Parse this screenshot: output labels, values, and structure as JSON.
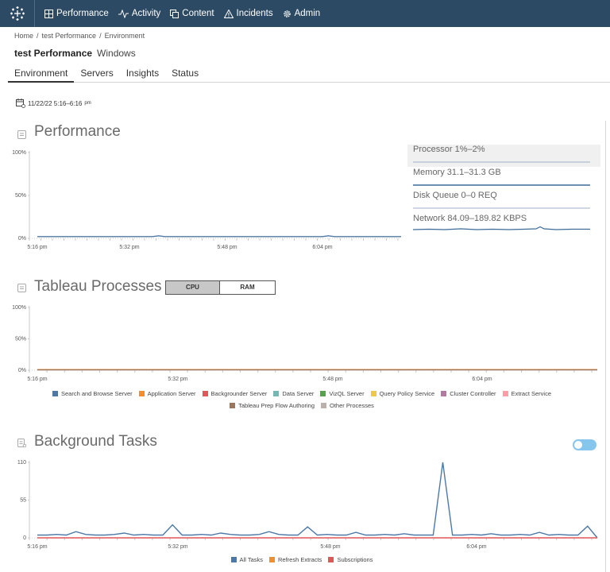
{
  "nav": {
    "logo": "tableau-logo",
    "items": [
      {
        "label": "Performance",
        "icon": "grid-icon"
      },
      {
        "label": "Activity",
        "icon": "pulse-icon"
      },
      {
        "label": "Content",
        "icon": "copy-icon"
      },
      {
        "label": "Incidents",
        "icon": "warning-icon"
      },
      {
        "label": "Admin",
        "icon": "gear-icon"
      }
    ]
  },
  "breadcrumb": [
    "Home",
    "test Performance",
    "Environment"
  ],
  "page": {
    "title": "test Performance",
    "subtitle": "Windows"
  },
  "tabs": [
    {
      "label": "Environment",
      "active": true
    },
    {
      "label": "Servers",
      "active": false
    },
    {
      "label": "Insights",
      "active": false
    },
    {
      "label": "Status",
      "active": false
    }
  ],
  "date_range": "11/22/22 5:16–6:16",
  "date_range_suffix": "pm",
  "sections": {
    "performance": "Performance",
    "processes": "Tableau Processes",
    "tasks": "Background Tasks"
  },
  "toggle": {
    "cpu": "CPU",
    "ram": "RAM",
    "selected": "CPU"
  },
  "metrics": [
    {
      "label": "Processor 1%–2%",
      "selected": true
    },
    {
      "label": "Memory 31.1–31.3 GB",
      "selected": false
    },
    {
      "label": "Disk Queue 0–0 REQ",
      "selected": false
    },
    {
      "label": "Network 84.09–189.82 KBPS",
      "selected": false
    }
  ],
  "colors": {
    "nav_bg": "#2d4a64",
    "line_blue": "#4e79a7",
    "orange": "#f28e2b",
    "red": "#e15759",
    "toggle_on": "#86c6ec"
  },
  "chart_data": [
    {
      "type": "line",
      "name": "performance",
      "x_ticks": [
        "5:16 pm",
        "5:32 pm",
        "5:48 pm",
        "6:04 pm"
      ],
      "y_ticks": [
        "100%",
        "50%",
        "0%"
      ],
      "ylim": [
        0,
        100
      ],
      "series": [
        {
          "values": [
            2,
            2,
            2,
            2,
            2,
            2,
            2,
            2,
            2,
            2,
            2,
            2,
            2,
            2,
            2,
            2,
            2,
            2,
            2,
            2,
            3,
            2,
            2,
            2,
            2,
            2,
            2,
            2,
            2,
            2,
            2,
            2,
            2,
            2,
            2,
            2,
            2,
            2,
            2,
            2,
            2,
            2,
            2,
            2,
            2,
            2,
            2,
            2,
            3,
            2,
            2,
            2,
            2,
            2,
            2,
            2,
            2,
            2,
            2,
            2,
            2
          ]
        }
      ]
    },
    {
      "type": "line",
      "name": "tableau-processes",
      "x_ticks": [
        "5:16 pm",
        "5:32 pm",
        "5:48 pm",
        "6:04 pm"
      ],
      "y_ticks": [
        "100%",
        "50%",
        "0%"
      ],
      "ylim": [
        0,
        100
      ],
      "legend": [
        {
          "name": "Search and Browse Server",
          "color": "#4e79a7"
        },
        {
          "name": "Application Server",
          "color": "#f28e2b"
        },
        {
          "name": "Backgrounder Server",
          "color": "#e15759"
        },
        {
          "name": "Data Server",
          "color": "#76b7b2"
        },
        {
          "name": "VizQL Server",
          "color": "#59a14f"
        },
        {
          "name": "Query Policy Service",
          "color": "#edc948"
        },
        {
          "name": "Cluster Controller",
          "color": "#b07aa1"
        },
        {
          "name": "Extract Service",
          "color": "#ff9da7"
        },
        {
          "name": "Tableau Prep Flow Authoring",
          "color": "#9c755f"
        },
        {
          "name": "Other Processes",
          "color": "#bab0ac"
        }
      ],
      "series": [
        {
          "name": "Application Server",
          "values": [
            1,
            1,
            1,
            1,
            1,
            1,
            1,
            1,
            1,
            1,
            1,
            1,
            1,
            1,
            1,
            1,
            1,
            1,
            1,
            1,
            1,
            1,
            1,
            1,
            1,
            1,
            1,
            1,
            1,
            1,
            1,
            1,
            1,
            1,
            1,
            1,
            1,
            1,
            1,
            1,
            1
          ]
        },
        {
          "name": "Tableau Prep Flow Authoring",
          "values": [
            0.5,
            0.5,
            0.5,
            0.5,
            0.5,
            0.5,
            0.5,
            0.5,
            0.5,
            0.5,
            0.5,
            0.5,
            0.5,
            0.5,
            0.5,
            0.5,
            0.5,
            0.5,
            0.5,
            0.5,
            0.5,
            0.5,
            0.5,
            0.5,
            0.5,
            0.5,
            0.5,
            0.5,
            0.5,
            0.5,
            0.5,
            0.5,
            0.5,
            0.5,
            0.5,
            0.5,
            0.5,
            0.5,
            0.5,
            0.5,
            0.5
          ]
        }
      ]
    },
    {
      "type": "line",
      "name": "background-tasks",
      "x_ticks": [
        "5:16 pm",
        "5:32 pm",
        "5:48 pm",
        "6:04 pm"
      ],
      "y_ticks": [
        "110",
        "55",
        "0"
      ],
      "ylim": [
        0,
        110
      ],
      "legend": [
        {
          "name": "All Tasks",
          "color": "#4e79a7"
        },
        {
          "name": "Refresh Extracts",
          "color": "#f28e2b"
        },
        {
          "name": "Subscriptions",
          "color": "#e15759"
        }
      ],
      "series": [
        {
          "name": "All Tasks",
          "values": [
            4,
            4,
            5,
            4,
            9,
            5,
            4,
            4,
            5,
            7,
            4,
            5,
            4,
            4,
            19,
            4,
            4,
            5,
            4,
            7,
            5,
            4,
            4,
            5,
            9,
            5,
            4,
            4,
            16,
            4,
            5,
            4,
            4,
            8,
            4,
            4,
            5,
            4,
            6,
            4,
            4,
            4,
            110,
            4,
            4,
            5,
            4,
            6,
            4,
            4,
            5,
            4,
            8,
            4,
            5,
            4,
            4,
            17,
            0
          ]
        },
        {
          "name": "Subscriptions",
          "values": [
            0,
            0,
            0,
            0,
            0,
            0,
            0,
            0,
            0,
            0,
            0,
            0,
            0,
            0,
            0,
            0,
            0,
            0,
            0,
            0,
            0,
            0,
            0,
            0,
            0,
            0,
            0,
            0,
            0,
            0,
            0,
            0,
            0,
            0,
            0,
            0,
            0,
            0,
            0,
            0,
            0,
            0,
            0,
            0,
            0,
            0,
            0,
            0,
            0,
            0,
            0,
            0,
            0,
            0,
            0,
            0,
            0,
            0,
            0
          ]
        }
      ]
    }
  ]
}
